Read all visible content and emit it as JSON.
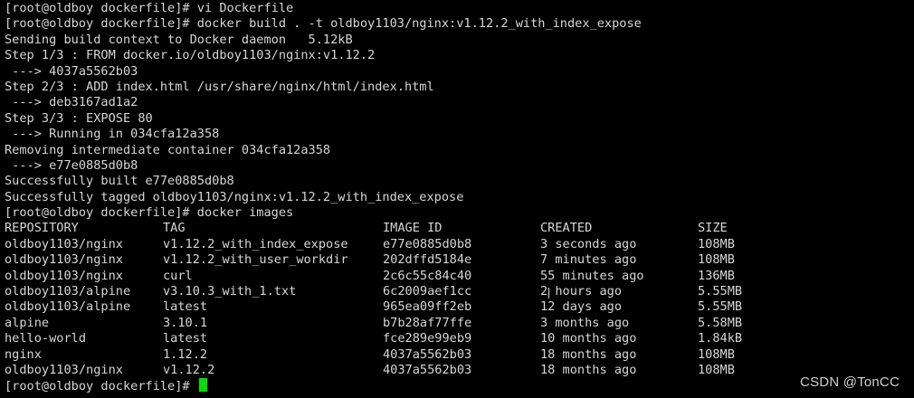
{
  "terminal": {
    "lines": [
      "[root@oldboy dockerfile]# vi Dockerfile",
      "[root@oldboy dockerfile]# docker build . -t oldboy1103/nginx:v1.12.2_with_index_expose",
      "Sending build context to Docker daemon   5.12kB",
      "Step 1/3 : FROM docker.io/oldboy1103/nginx:v1.12.2",
      " ---> 4037a5562b03",
      "Step 2/3 : ADD index.html /usr/share/nginx/html/index.html",
      " ---> deb3167ad1a2",
      "Step 3/3 : EXPOSE 80",
      " ---> Running in 034cfa12a358",
      "Removing intermediate container 034cfa12a358",
      " ---> e77e0885d0b8",
      "Successfully built e77e0885d0b8",
      "Successfully tagged oldboy1103/nginx:v1.12.2_with_index_expose",
      "[root@oldboy dockerfile]# docker images"
    ],
    "images_table": {
      "headers": [
        "REPOSITORY",
        "TAG",
        "IMAGE ID",
        "CREATED",
        "SIZE"
      ],
      "rows": [
        [
          "oldboy1103/nginx",
          "v1.12.2_with_index_expose",
          "e77e0885d0b8",
          "3 seconds ago",
          "108MB"
        ],
        [
          "oldboy1103/nginx",
          "v1.12.2_with_user_workdir",
          "202dffd5184e",
          "7 minutes ago",
          "108MB"
        ],
        [
          "oldboy1103/nginx",
          "curl",
          "2c6c55c84c40",
          "55 minutes ago",
          "136MB"
        ],
        [
          "oldboy1103/alpine",
          "v3.10.3_with_1.txt",
          "6c2009aef1cc",
          "2 hours ago",
          "5.55MB"
        ],
        [
          "oldboy1103/alpine",
          "latest",
          "965ea09ff2eb",
          "12 days ago",
          "5.55MB"
        ],
        [
          "alpine",
          "3.10.1",
          "b7b28af77ffe",
          "3 months ago",
          "5.58MB"
        ],
        [
          "hello-world",
          "latest",
          "fce289e99eb9",
          "10 months ago",
          "1.84kB"
        ],
        [
          "nginx",
          "1.12.2",
          "4037a5562b03",
          "18 months ago",
          "108MB"
        ],
        [
          "oldboy1103/nginx",
          "v1.12.2",
          "4037a5562b03",
          "18 months ago",
          "108MB"
        ]
      ]
    },
    "prompt": "[root@oldboy dockerfile]# ",
    "cursor_color": "#00e000",
    "background_color": "#000000",
    "text_color": "#d6d6d6"
  },
  "watermark": "CSDN @TonCC"
}
